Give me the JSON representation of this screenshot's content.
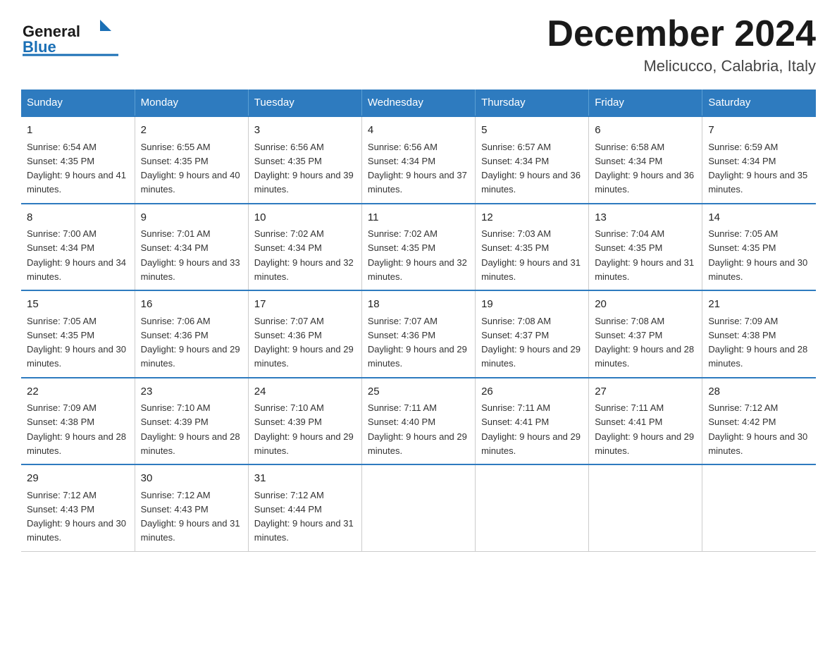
{
  "logo": {
    "general": "General",
    "blue": "Blue"
  },
  "header": {
    "title": "December 2024",
    "subtitle": "Melicucco, Calabria, Italy"
  },
  "days_of_week": [
    "Sunday",
    "Monday",
    "Tuesday",
    "Wednesday",
    "Thursday",
    "Friday",
    "Saturday"
  ],
  "weeks": [
    [
      {
        "day": "1",
        "sunrise": "Sunrise: 6:54 AM",
        "sunset": "Sunset: 4:35 PM",
        "daylight": "Daylight: 9 hours and 41 minutes."
      },
      {
        "day": "2",
        "sunrise": "Sunrise: 6:55 AM",
        "sunset": "Sunset: 4:35 PM",
        "daylight": "Daylight: 9 hours and 40 minutes."
      },
      {
        "day": "3",
        "sunrise": "Sunrise: 6:56 AM",
        "sunset": "Sunset: 4:35 PM",
        "daylight": "Daylight: 9 hours and 39 minutes."
      },
      {
        "day": "4",
        "sunrise": "Sunrise: 6:56 AM",
        "sunset": "Sunset: 4:34 PM",
        "daylight": "Daylight: 9 hours and 37 minutes."
      },
      {
        "day": "5",
        "sunrise": "Sunrise: 6:57 AM",
        "sunset": "Sunset: 4:34 PM",
        "daylight": "Daylight: 9 hours and 36 minutes."
      },
      {
        "day": "6",
        "sunrise": "Sunrise: 6:58 AM",
        "sunset": "Sunset: 4:34 PM",
        "daylight": "Daylight: 9 hours and 36 minutes."
      },
      {
        "day": "7",
        "sunrise": "Sunrise: 6:59 AM",
        "sunset": "Sunset: 4:34 PM",
        "daylight": "Daylight: 9 hours and 35 minutes."
      }
    ],
    [
      {
        "day": "8",
        "sunrise": "Sunrise: 7:00 AM",
        "sunset": "Sunset: 4:34 PM",
        "daylight": "Daylight: 9 hours and 34 minutes."
      },
      {
        "day": "9",
        "sunrise": "Sunrise: 7:01 AM",
        "sunset": "Sunset: 4:34 PM",
        "daylight": "Daylight: 9 hours and 33 minutes."
      },
      {
        "day": "10",
        "sunrise": "Sunrise: 7:02 AM",
        "sunset": "Sunset: 4:34 PM",
        "daylight": "Daylight: 9 hours and 32 minutes."
      },
      {
        "day": "11",
        "sunrise": "Sunrise: 7:02 AM",
        "sunset": "Sunset: 4:35 PM",
        "daylight": "Daylight: 9 hours and 32 minutes."
      },
      {
        "day": "12",
        "sunrise": "Sunrise: 7:03 AM",
        "sunset": "Sunset: 4:35 PM",
        "daylight": "Daylight: 9 hours and 31 minutes."
      },
      {
        "day": "13",
        "sunrise": "Sunrise: 7:04 AM",
        "sunset": "Sunset: 4:35 PM",
        "daylight": "Daylight: 9 hours and 31 minutes."
      },
      {
        "day": "14",
        "sunrise": "Sunrise: 7:05 AM",
        "sunset": "Sunset: 4:35 PM",
        "daylight": "Daylight: 9 hours and 30 minutes."
      }
    ],
    [
      {
        "day": "15",
        "sunrise": "Sunrise: 7:05 AM",
        "sunset": "Sunset: 4:35 PM",
        "daylight": "Daylight: 9 hours and 30 minutes."
      },
      {
        "day": "16",
        "sunrise": "Sunrise: 7:06 AM",
        "sunset": "Sunset: 4:36 PM",
        "daylight": "Daylight: 9 hours and 29 minutes."
      },
      {
        "day": "17",
        "sunrise": "Sunrise: 7:07 AM",
        "sunset": "Sunset: 4:36 PM",
        "daylight": "Daylight: 9 hours and 29 minutes."
      },
      {
        "day": "18",
        "sunrise": "Sunrise: 7:07 AM",
        "sunset": "Sunset: 4:36 PM",
        "daylight": "Daylight: 9 hours and 29 minutes."
      },
      {
        "day": "19",
        "sunrise": "Sunrise: 7:08 AM",
        "sunset": "Sunset: 4:37 PM",
        "daylight": "Daylight: 9 hours and 29 minutes."
      },
      {
        "day": "20",
        "sunrise": "Sunrise: 7:08 AM",
        "sunset": "Sunset: 4:37 PM",
        "daylight": "Daylight: 9 hours and 28 minutes."
      },
      {
        "day": "21",
        "sunrise": "Sunrise: 7:09 AM",
        "sunset": "Sunset: 4:38 PM",
        "daylight": "Daylight: 9 hours and 28 minutes."
      }
    ],
    [
      {
        "day": "22",
        "sunrise": "Sunrise: 7:09 AM",
        "sunset": "Sunset: 4:38 PM",
        "daylight": "Daylight: 9 hours and 28 minutes."
      },
      {
        "day": "23",
        "sunrise": "Sunrise: 7:10 AM",
        "sunset": "Sunset: 4:39 PM",
        "daylight": "Daylight: 9 hours and 28 minutes."
      },
      {
        "day": "24",
        "sunrise": "Sunrise: 7:10 AM",
        "sunset": "Sunset: 4:39 PM",
        "daylight": "Daylight: 9 hours and 29 minutes."
      },
      {
        "day": "25",
        "sunrise": "Sunrise: 7:11 AM",
        "sunset": "Sunset: 4:40 PM",
        "daylight": "Daylight: 9 hours and 29 minutes."
      },
      {
        "day": "26",
        "sunrise": "Sunrise: 7:11 AM",
        "sunset": "Sunset: 4:41 PM",
        "daylight": "Daylight: 9 hours and 29 minutes."
      },
      {
        "day": "27",
        "sunrise": "Sunrise: 7:11 AM",
        "sunset": "Sunset: 4:41 PM",
        "daylight": "Daylight: 9 hours and 29 minutes."
      },
      {
        "day": "28",
        "sunrise": "Sunrise: 7:12 AM",
        "sunset": "Sunset: 4:42 PM",
        "daylight": "Daylight: 9 hours and 30 minutes."
      }
    ],
    [
      {
        "day": "29",
        "sunrise": "Sunrise: 7:12 AM",
        "sunset": "Sunset: 4:43 PM",
        "daylight": "Daylight: 9 hours and 30 minutes."
      },
      {
        "day": "30",
        "sunrise": "Sunrise: 7:12 AM",
        "sunset": "Sunset: 4:43 PM",
        "daylight": "Daylight: 9 hours and 31 minutes."
      },
      {
        "day": "31",
        "sunrise": "Sunrise: 7:12 AM",
        "sunset": "Sunset: 4:44 PM",
        "daylight": "Daylight: 9 hours and 31 minutes."
      },
      null,
      null,
      null,
      null
    ]
  ]
}
